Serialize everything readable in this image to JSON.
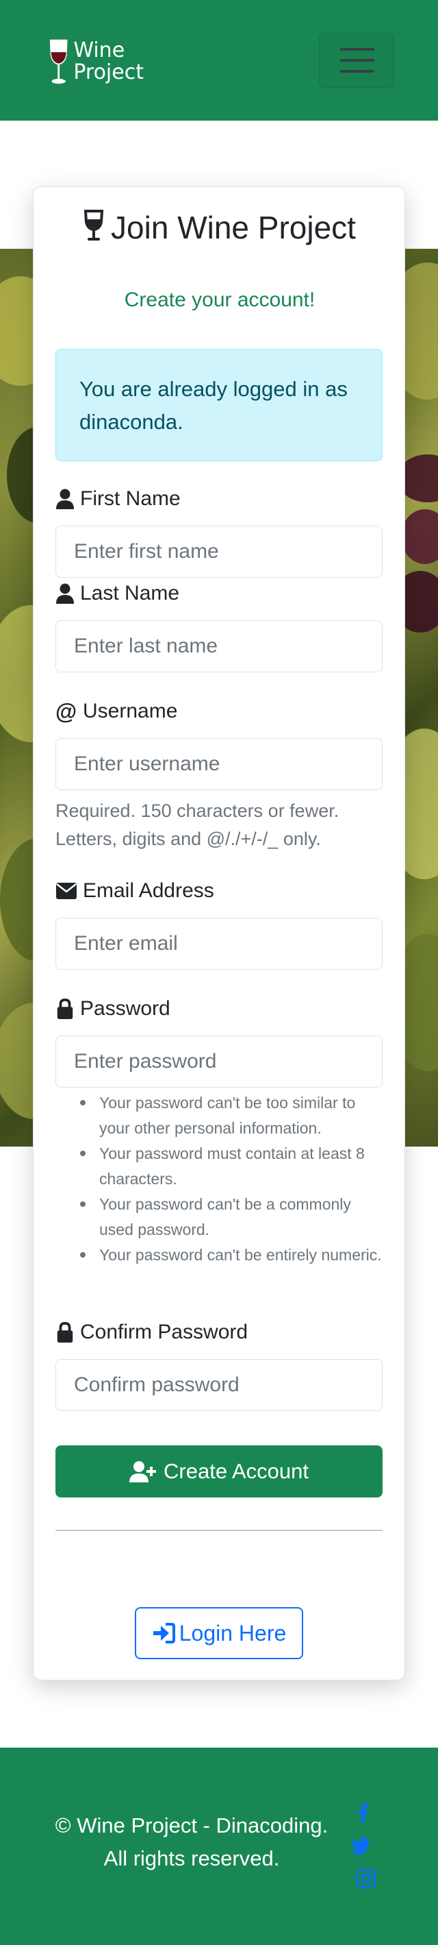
{
  "navbar": {
    "brand_line1": "Wine",
    "brand_line2": "Project"
  },
  "card": {
    "title": "Join Wine Project",
    "subtitle": "Create your account!",
    "alert_text": "You are already logged in as dinaconda."
  },
  "form": {
    "first_name": {
      "label": "First Name",
      "placeholder": "Enter first name"
    },
    "last_name": {
      "label": "Last Name",
      "placeholder": "Enter last name"
    },
    "username": {
      "label": "Username",
      "placeholder": "Enter username",
      "help": "Required. 150 characters or fewer. Letters, digits and @/./+/-/_ only."
    },
    "email": {
      "label": "Email Address",
      "placeholder": "Enter email"
    },
    "password": {
      "label": "Password",
      "placeholder": "Enter password",
      "rules": [
        "Your password can't be too similar to your other personal information.",
        "Your password must contain at least 8 characters.",
        "Your password can't be a commonly used password.",
        "Your password can't be entirely numeric."
      ]
    },
    "confirm_password": {
      "label": "Confirm Password",
      "placeholder": "Confirm password"
    },
    "submit_label": "Create Account",
    "login_label": "Login Here"
  },
  "footer": {
    "line1": "© Wine Project - Dinacoding.",
    "line2": "All rights reserved.",
    "social_icons": [
      "facebook-icon",
      "twitter-icon",
      "instagram-icon"
    ]
  },
  "colors": {
    "primary_green": "#198754",
    "link_blue": "#0d6efd",
    "alert_bg": "#cff4fc",
    "alert_text": "#055160"
  }
}
